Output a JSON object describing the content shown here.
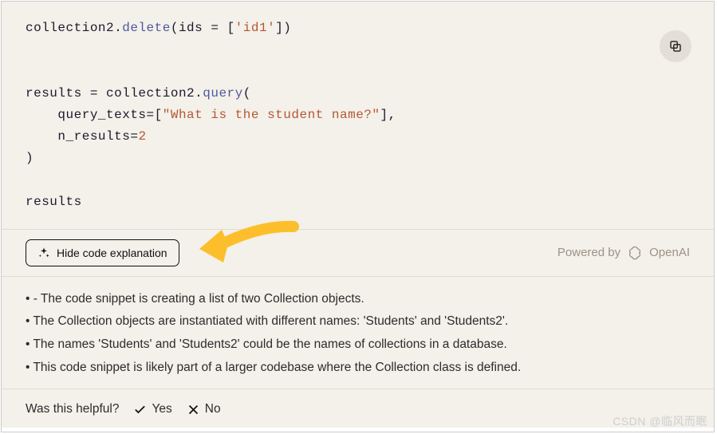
{
  "code": {
    "line1_a": "collection2",
    "line1_b": ".",
    "line1_c": "delete",
    "line1_d": "(",
    "line1_e": "ids ",
    "line1_f": "=",
    "line1_g": " [",
    "line1_h": "'id1'",
    "line1_i": "])",
    "line2_a": "results ",
    "line2_b": "=",
    "line2_c": " collection2",
    "line2_d": ".",
    "line2_e": "query",
    "line2_f": "(",
    "line3_a": "    query_texts",
    "line3_b": "=",
    "line3_c": "[",
    "line3_d": "\"What is the student name?\"",
    "line3_e": "],",
    "line4_a": "    n_results",
    "line4_b": "=",
    "line4_c": "2",
    "line5_a": ")",
    "line6_a": "results"
  },
  "toggle": {
    "hide_label": "Hide code explanation"
  },
  "powered": {
    "prefix": "Powered by",
    "brand": "OpenAI"
  },
  "explain": {
    "items": [
      "- The code snippet is creating a list of two Collection objects.",
      "The Collection objects are instantiated with different names: 'Students' and 'Students2'.",
      "The names 'Students' and 'Students2' could be the names of collections in a database.",
      "This code snippet is likely part of a larger codebase where the Collection class is defined."
    ]
  },
  "feedback": {
    "prompt": "Was this helpful?",
    "yes": "Yes",
    "no": "No"
  },
  "watermark": "CSDN @临风而眠"
}
